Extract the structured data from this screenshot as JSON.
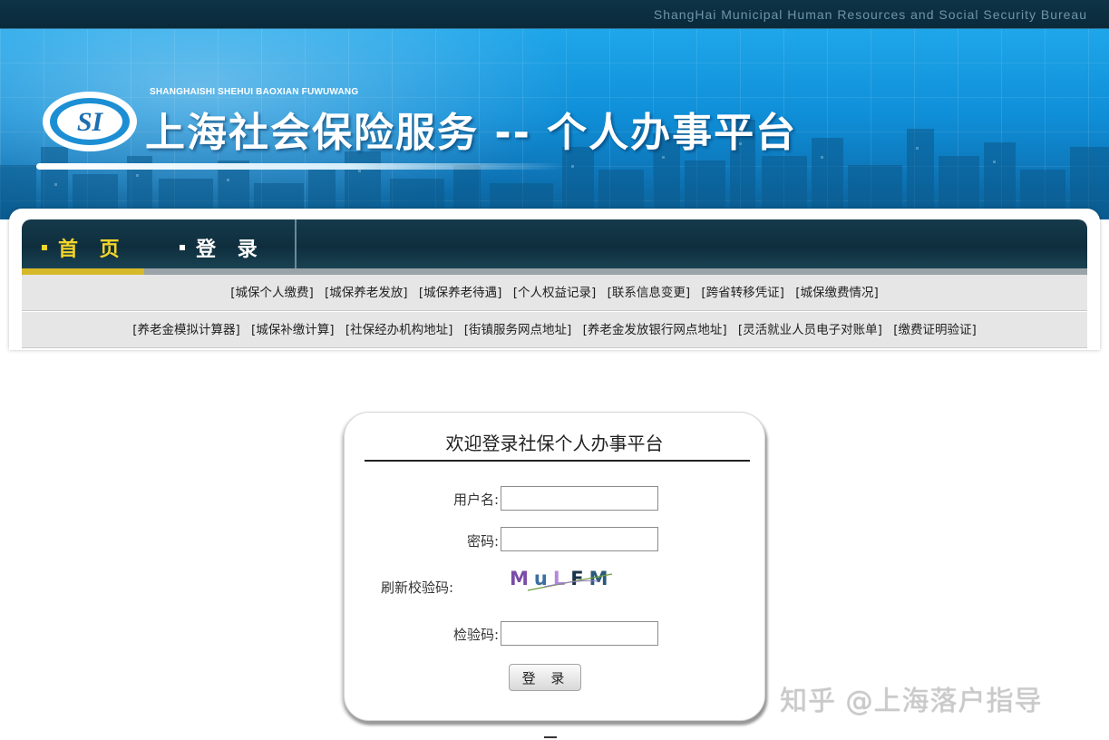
{
  "header": {
    "bureau": "ShangHai Municipal Human Resources and Social Security Bureau",
    "logo_text": "SI",
    "logo_subtitle": "SHANGHAISHI SHEHUI BAOXIAN FUWUWANG",
    "title": "上海社会保险服务 -- 个人办事平台"
  },
  "nav": {
    "home": "首 页",
    "login": "登 录"
  },
  "links_row1": [
    "[城保个人缴费]",
    "[城保养老发放]",
    "[城保养老待遇]",
    "[个人权益记录]",
    "[联系信息变更]",
    "[跨省转移凭证]",
    "[城保缴费情况]"
  ],
  "links_row2": [
    "[养老金模拟计算器]",
    "[城保补缴计算]",
    "[社保经办机构地址]",
    "[街镇服务网点地址]",
    "[养老金发放银行网点地址]",
    "[灵活就业人员电子对账单]",
    "[缴费证明验证]"
  ],
  "login": {
    "title": "欢迎登录社保个人办事平台",
    "username_label": "用户名:",
    "password_label": "密码:",
    "refresh_label": "刷新校验码:",
    "code_label": "检验码:",
    "captcha_text": "MuLFM",
    "submit": "登 录"
  },
  "watermark": "知乎 @上海落户指导",
  "colors": {
    "banner_blue": "#1fa6ea",
    "nav_dark": "#153a4b",
    "nav_active": "#f3d42a",
    "link_bar": "#e6e6e6"
  }
}
